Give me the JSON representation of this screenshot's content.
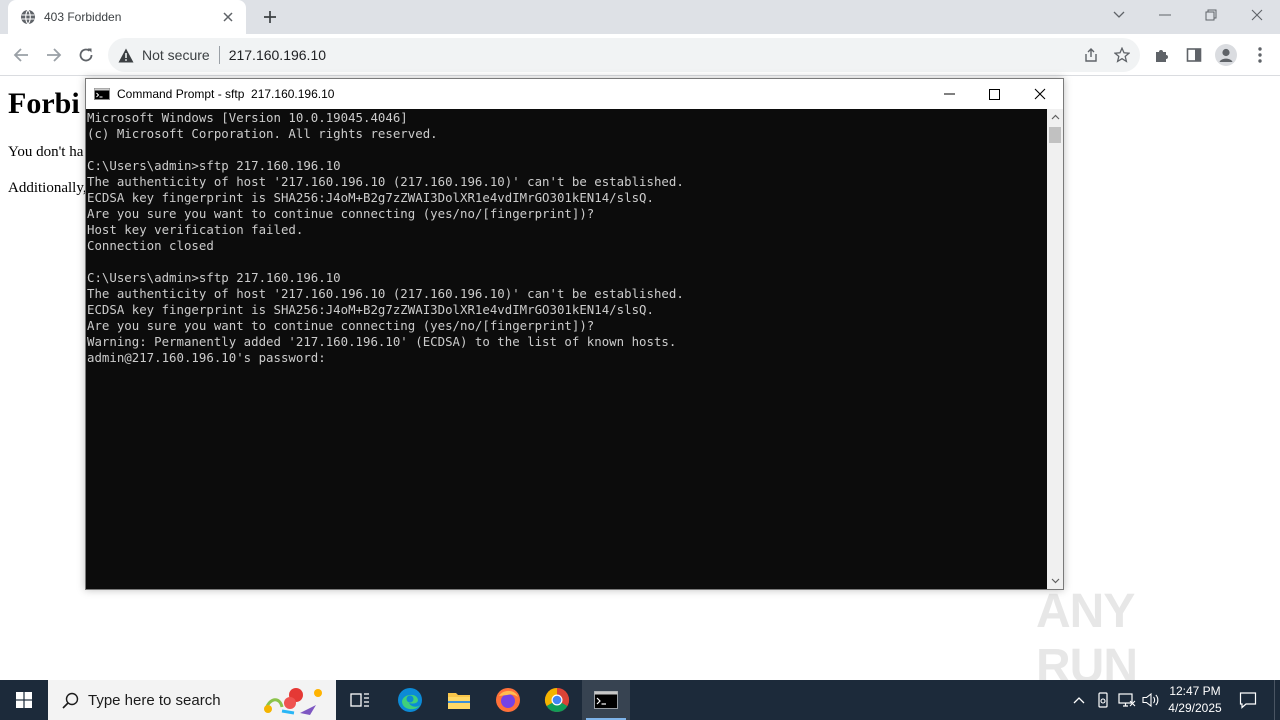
{
  "browser": {
    "tab_title": "403 Forbidden",
    "security_label": "Not secure",
    "url": "217.160.196.10"
  },
  "page": {
    "heading": "Forbi",
    "line1": "You don't ha",
    "line2": "Additionally,"
  },
  "cmd": {
    "title": "Command Prompt - sftp  217.160.196.10",
    "output": "Microsoft Windows [Version 10.0.19045.4046]\n(c) Microsoft Corporation. All rights reserved.\n\nC:\\Users\\admin>sftp 217.160.196.10\nThe authenticity of host '217.160.196.10 (217.160.196.10)' can't be established.\nECDSA key fingerprint is SHA256:J4oM+B2g7zZWAI3DolXR1e4vdIMrGO301kEN14/slsQ.\nAre you sure you want to continue connecting (yes/no/[fingerprint])?\nHost key verification failed.\nConnection closed\n\nC:\\Users\\admin>sftp 217.160.196.10\nThe authenticity of host '217.160.196.10 (217.160.196.10)' can't be established.\nECDSA key fingerprint is SHA256:J4oM+B2g7zZWAI3DolXR1e4vdIMrGO301kEN14/slsQ.\nAre you sure you want to continue connecting (yes/no/[fingerprint])?\nWarning: Permanently added '217.160.196.10' (ECDSA) to the list of known hosts.\nadmin@217.160.196.10's password:"
  },
  "watermark": {
    "text": "ANY RUN"
  },
  "taskbar": {
    "search_placeholder": "Type here to search",
    "time": "12:47 PM",
    "date": "4/29/2025"
  },
  "colors": {
    "taskbar_bg": "#1c2a3a",
    "console_bg": "#0c0c0c",
    "console_fg": "#cccccc",
    "tab_strip": "#dee1e6"
  }
}
